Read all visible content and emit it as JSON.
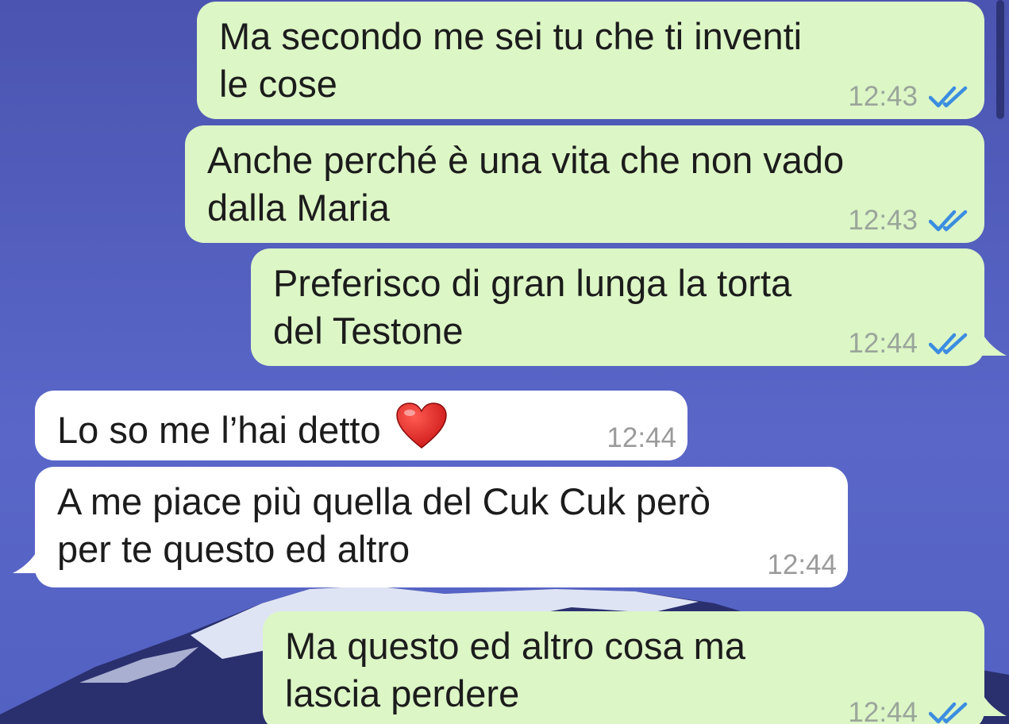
{
  "colors": {
    "outgoing_bubble": "#dcf6c6",
    "incoming_bubble": "#ffffff",
    "read_ticks": "#3b8de0",
    "wallpaper": "#5563c2"
  },
  "messages": [
    {
      "direction": "outgoing",
      "text": "Ma secondo me sei tu che ti inventi\nle cose",
      "time": "12:43",
      "status": "read-ticks-icon"
    },
    {
      "direction": "outgoing",
      "text": "Anche perché è una vita che non vado\ndalla Maria",
      "time": "12:43",
      "status": "read-ticks-icon"
    },
    {
      "direction": "outgoing",
      "text": "Preferisco di gran lunga la torta\ndel Testone",
      "time": "12:44",
      "status": "read-ticks-icon"
    },
    {
      "direction": "incoming",
      "text": "Lo so me l’hai detto",
      "emoji": "heart-emoji",
      "time": "12:44"
    },
    {
      "direction": "incoming",
      "text": "A me piace più quella del Cuk Cuk però\nper te questo ed altro",
      "time": "12:44"
    },
    {
      "direction": "outgoing",
      "text": "Ma questo ed altro cosa ma\nlascia perdere",
      "time": "12:44",
      "status": "read-ticks-icon"
    }
  ]
}
